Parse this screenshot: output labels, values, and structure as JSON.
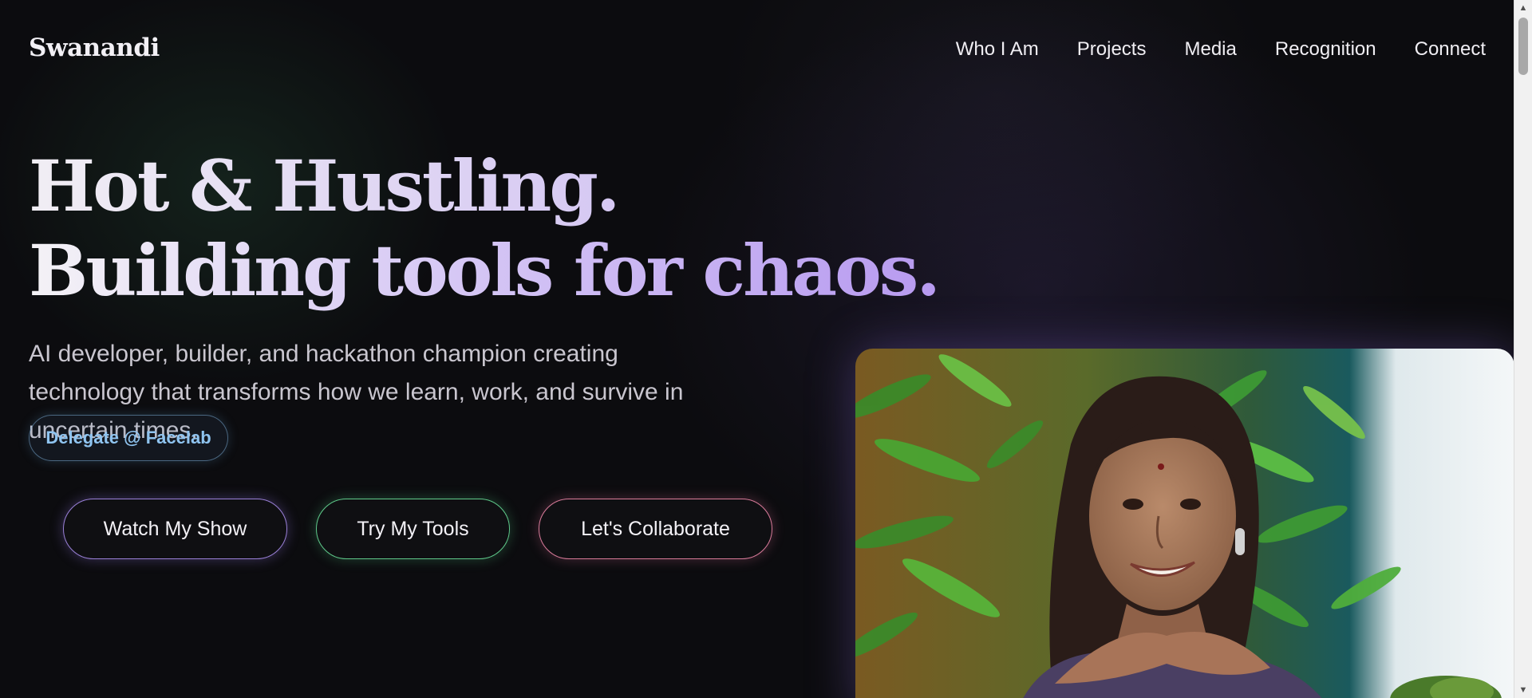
{
  "brand": {
    "name": "Swanandi"
  },
  "nav": {
    "items": [
      {
        "label": "Who I Am"
      },
      {
        "label": "Projects"
      },
      {
        "label": "Media"
      },
      {
        "label": "Recognition"
      },
      {
        "label": "Connect"
      }
    ]
  },
  "hero": {
    "headline_line1": "Hot & Hustling.",
    "headline_line2": "Building tools for chaos.",
    "lead": "AI developer, builder, and hackathon champion creating technology that transforms how we learn, work, and survive in uncertain times.",
    "badge": "Delegate @ Facelab",
    "buttons": {
      "show": "Watch My Show",
      "tools": "Try My Tools",
      "collab": "Let's Collaborate"
    },
    "photo_icon": "portrait-photo"
  },
  "colors": {
    "background": "#0c0c0f",
    "accent_purple": "#b79af0",
    "accent_green": "#5fc98a",
    "accent_pink": "#d97b9a",
    "badge_blue": "#8fc4f0"
  },
  "scrollbar": {
    "up_icon": "arrow-up-icon",
    "down_icon": "arrow-down-icon"
  }
}
